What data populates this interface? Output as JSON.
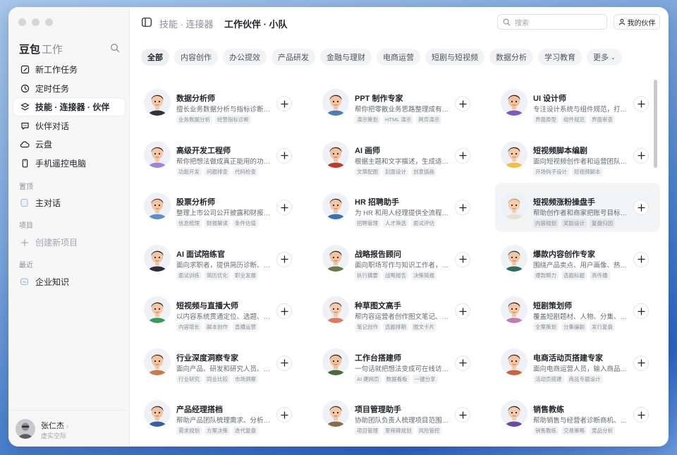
{
  "sidebar": {
    "brand": "豆包",
    "brand_sub": "工作",
    "nav": [
      {
        "label": "新工作任务",
        "icon": "edit-icon"
      },
      {
        "label": "定时任务",
        "icon": "clock-icon"
      },
      {
        "label": "技能 · 连接器 · 伙伴",
        "icon": "layers-icon",
        "active": true
      },
      {
        "label": "伙伴对话",
        "icon": "chat-icon"
      },
      {
        "label": "云盘",
        "icon": "cloud-icon"
      },
      {
        "label": "手机遥控电脑",
        "icon": "phone-icon"
      }
    ],
    "pinned_label": "置顶",
    "pinned_item": "主对话",
    "projects_label": "项目",
    "new_project": "创建新项目",
    "recent_label": "最近",
    "recent_item": "企业知识",
    "user": {
      "name": "张仁杰",
      "sub": "虚实空际"
    }
  },
  "header": {
    "crumb": "技能 · 连接器",
    "title": "工作伙伴 · 小队",
    "search_placeholder": "搜索",
    "partner_button": "我的伙伴"
  },
  "tabs": [
    {
      "label": "全部",
      "active": true
    },
    {
      "label": "内容创作"
    },
    {
      "label": "办公提效"
    },
    {
      "label": "产品研发"
    },
    {
      "label": "金融与理财"
    },
    {
      "label": "电商运营"
    },
    {
      "label": "短剧与短视频"
    },
    {
      "label": "数据分析"
    },
    {
      "label": "学习教育"
    },
    {
      "label": "更多"
    }
  ],
  "cards": [
    {
      "name": "数据分析师",
      "desc": "擅长业务数据分析与指标诊断…",
      "tags": [
        "业务数据分析",
        "经营指标诊断"
      ],
      "skin": "#f4c9a8",
      "hair": "#2b2220",
      "shirt": "#2d3440"
    },
    {
      "name": "PPT 制作专家",
      "desc": "帮你把零散业务思路整理成有…",
      "tags": [
        "演示策划",
        "HTML 演示",
        "网页演示"
      ],
      "skin": "#f2c6a4",
      "hair": "#2a1d18",
      "shirt": "#4a7fb5"
    },
    {
      "name": "UI 设计师",
      "desc": "专注设计系统与组件规范，打…",
      "tags": [
        "界面原型",
        "组件规范",
        "界面审查"
      ],
      "skin": "#f0c39e",
      "hair": "#1e1e22",
      "shirt": "#7a5cc0"
    },
    {
      "name": "高级开发工程师",
      "desc": "帮你把想法做成真正能用的功…",
      "tags": [
        "功能开发",
        "问题排查",
        "代码检查"
      ],
      "skin": "#f3c8a6",
      "hair": "#2c2a2a",
      "shirt": "#9b86d8"
    },
    {
      "name": "AI 画师",
      "desc": "根据主题和文字描述，生成适…",
      "tags": [
        "文章配图",
        "封面设计",
        "创意插画"
      ],
      "skin": "#f1c2a0",
      "hair": "#3a1f16",
      "shirt": "#c0392b"
    },
    {
      "name": "短视频脚本编剧",
      "desc": "面向短视频创作者和运营团队…",
      "tags": [
        "开场钩子设计",
        "短视频脚本"
      ],
      "skin": "#f4cba8",
      "hair": "#2a1e16",
      "shirt": "#f0c040"
    },
    {
      "name": "股票分析师",
      "desc": "整理上市公司公开披露和财报…",
      "tags": [
        "信息梳理",
        "财报解读",
        "条件估值"
      ],
      "skin": "#f2c5a2",
      "hair": "#6b2d2d",
      "shirt": "#5b8fd0"
    },
    {
      "name": "HR 招聘助手",
      "desc": "为 HR 和用人经理提供全流程…",
      "tags": [
        "招聘管理",
        "人才筛选",
        "面试评估"
      ],
      "skin": "#f3c7a5",
      "hair": "#2b2220",
      "shirt": "#3b6fb6"
    },
    {
      "name": "短视频涨粉操盘手",
      "desc": "帮助创作者和商家把账号目标…",
      "tags": [
        "内容规划",
        "奖励设计",
        "复盘归因"
      ],
      "skin": "#f5cfae",
      "hair": "#c89a5c",
      "shirt": "#e8e0d0",
      "hover": true
    },
    {
      "name": "AI 面试陪练官",
      "desc": "面向求职者，提供简历诊断、…",
      "tags": [
        "面试训练",
        "简历优化",
        "职业发展"
      ],
      "skin": "#f2c6a4",
      "hair": "#1e1a18",
      "shirt": "#2d2d33"
    },
    {
      "name": "战略报告顾问",
      "desc": "面向职场写作与知识工作者，…",
      "tags": [
        "执行摘要",
        "战略报告",
        "决策简报"
      ],
      "skin": "#f1c4a0",
      "hair": "#2a221c",
      "shirt": "#6b7a4a"
    },
    {
      "name": "爆款内容创作专家",
      "desc": "围绕产品卖点、用户画像、热…",
      "tags": [
        "爆款瞬力",
        "选题标题",
        "高传播"
      ],
      "skin": "#f3c6a3",
      "hair": "#263a33",
      "shirt": "#2f6b5a"
    },
    {
      "name": "短视频与直播大师",
      "desc": "以内容系统贯通定位、选题、…",
      "tags": [
        "内容增长",
        "脚本创作",
        "直播运营"
      ],
      "skin": "#f3c8a5",
      "hair": "#24201c",
      "shirt": "#3a9a5c"
    },
    {
      "name": "种草图文高手",
      "desc": "帮内容运营者创作图文笔记、…",
      "tags": [
        "笔记创作",
        "选题排期",
        "图文卡片"
      ],
      "skin": "#f4cbaa",
      "hair": "#5a3222",
      "shirt": "#e07a5f"
    },
    {
      "name": "短剧策划师",
      "desc": "覆盖短剧题材、人物、分集、…",
      "tags": [
        "全案策划",
        "分集编剧",
        "发行复盘"
      ],
      "skin": "#f3c6a4",
      "hair": "#2a1d18",
      "shirt": "#c47ab0"
    },
    {
      "name": "行业深度洞察专家",
      "desc": "面向产品、研发和研究人员、…",
      "tags": [
        "行业研究",
        "同业比较",
        "市场洞察"
      ],
      "skin": "#f2c4a1",
      "hair": "#3a2a20",
      "shirt": "#c87a4a"
    },
    {
      "name": "工作台搭建师",
      "desc": "一句话就把想法变成可在线访…",
      "tags": [
        "AI 建网页",
        "数据看板",
        "一键分享"
      ],
      "skin": "#f1c29e",
      "hair": "#1f1f22",
      "shirt": "#4a6b3a"
    },
    {
      "name": "电商活动页搭建专家",
      "desc": "面向电商运营人员，输入商品…",
      "tags": [
        "活动页搭建",
        "商品专题设计"
      ],
      "skin": "#f3c7a4",
      "hair": "#2a2a30",
      "shirt": "#d1603d"
    },
    {
      "name": "产品经理搭档",
      "desc": "帮助产品团队梳理需求、分析…",
      "tags": [
        "需求规划",
        "方案决策",
        "迭代复盘"
      ],
      "skin": "#f2c5a3",
      "hair": "#2b2420",
      "shirt": "#3a5fa0"
    },
    {
      "name": "项目管理助手",
      "desc": "协助团队负责人梳理项目范围…",
      "tags": [
        "项目管理",
        "里程碑规划",
        "风险管控"
      ],
      "skin": "#f3c8a6",
      "hair": "#3a2a20",
      "shirt": "#8a6a4a"
    },
    {
      "name": "销售教练",
      "desc": "帮助销售与经营者诊断商机、…",
      "tags": [
        "销售教练",
        "交易策略",
        "竞品分析"
      ],
      "skin": "#f4cbaa",
      "hair": "#2a1d18",
      "shirt": "#6b4aa0"
    }
  ]
}
